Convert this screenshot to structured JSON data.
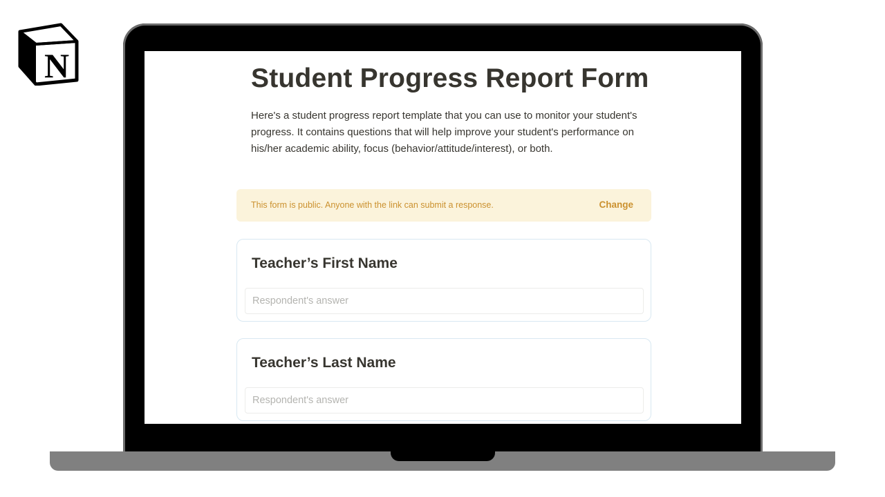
{
  "logo": {
    "letter": "N",
    "icon": "notion-logo-icon"
  },
  "form": {
    "title": "Student Progress Report Form",
    "description": "Here's a student progress report template that you can use to monitor your student's progress. It contains questions that will help improve your student's performance on his/her academic ability, focus (behavior/attitude/interest), or both.",
    "notice": {
      "text": "This form is public. Anyone with the link can submit a response.",
      "action_label": "Change"
    },
    "questions": [
      {
        "title": "Teacher’s First Name",
        "placeholder": "Respondent's answer"
      },
      {
        "title": "Teacher’s Last Name",
        "placeholder": "Respondent's answer"
      }
    ]
  },
  "colors": {
    "text": "#37352f",
    "notice_bg": "#fbf3db",
    "notice_text": "#cb912f",
    "card_border": "#d8e8f2",
    "placeholder": "#b4b4b0"
  }
}
